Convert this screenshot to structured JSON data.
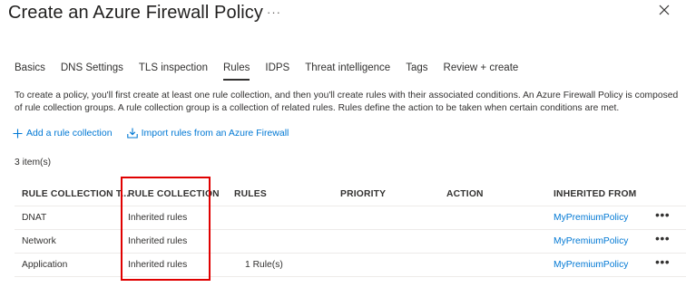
{
  "header": {
    "title": "Create an Azure Firewall Policy",
    "more": "···"
  },
  "tabs": [
    {
      "label": "Basics",
      "active": false
    },
    {
      "label": "DNS Settings",
      "active": false
    },
    {
      "label": "TLS inspection",
      "active": false
    },
    {
      "label": "Rules",
      "active": true
    },
    {
      "label": "IDPS",
      "active": false
    },
    {
      "label": "Threat intelligence",
      "active": false
    },
    {
      "label": "Tags",
      "active": false
    },
    {
      "label": "Review + create",
      "active": false
    }
  ],
  "description": "To create a policy, you'll first create at least one rule collection, and then you'll create rules with their associated conditions. An Azure Firewall Policy is composed of rule collection groups. A rule collection group is a collection of related rules. Rules define the action to be taken when certain conditions are met.",
  "actions": {
    "add_rule_collection": "Add a rule collection",
    "import_rules": "Import rules from an Azure Firewall"
  },
  "item_count": "3 item(s)",
  "table": {
    "columns": [
      "RULE COLLECTION T...",
      "RULE COLLECTION",
      "RULES",
      "PRIORITY",
      "ACTION",
      "INHERITED FROM"
    ],
    "rows": [
      {
        "type": "DNAT",
        "collection": "Inherited rules",
        "rules": "",
        "priority": "",
        "action": "",
        "inherited_from": "MyPremiumPolicy",
        "more": "•••"
      },
      {
        "type": "Network",
        "collection": "Inherited rules",
        "rules": "",
        "priority": "",
        "action": "",
        "inherited_from": "MyPremiumPolicy",
        "more": "•••"
      },
      {
        "type": "Application",
        "collection": "Inherited rules",
        "rules": "1 Rule(s)",
        "priority": "",
        "action": "",
        "inherited_from": "MyPremiumPolicy",
        "more": "•••"
      }
    ]
  },
  "colors": {
    "link": "#0078d4",
    "highlight": "#e00000",
    "text": "#323130"
  }
}
